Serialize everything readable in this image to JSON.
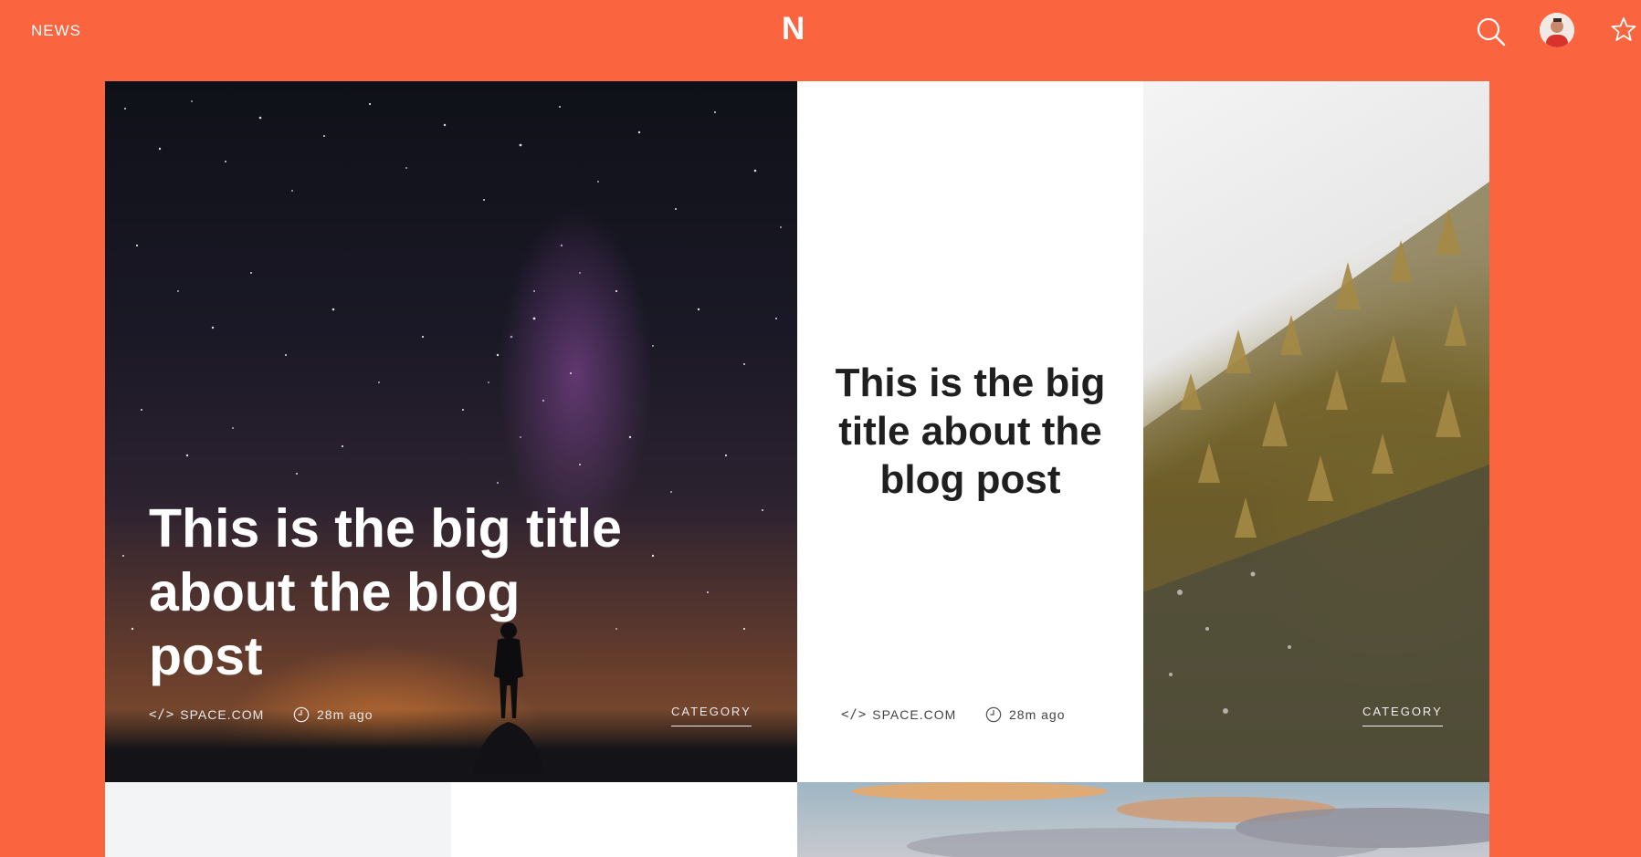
{
  "header": {
    "nav_label": "NEWS",
    "logo": "N",
    "icons": [
      "search-icon",
      "avatar",
      "star-icon"
    ]
  },
  "featured": {
    "title": "This is the big title about the blog post",
    "source_icon": "</>",
    "source": "SPACE.COM",
    "time": "28m ago",
    "category": "CATEGORY"
  },
  "secondary": {
    "title": "This is the big title about the blog post",
    "source_icon": "</>",
    "source": "SPACE.COM",
    "time": "28m ago",
    "category": "CATEGORY"
  },
  "colors": {
    "accent": "#FA643E",
    "white": "#FFFFFF",
    "dark_text": "#1F1F1F"
  }
}
